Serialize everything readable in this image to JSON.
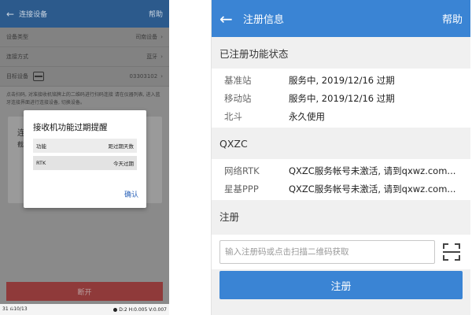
{
  "left_screen": {
    "app_bar": {
      "title": "连接设备",
      "help": "帮助"
    },
    "rows": [
      {
        "label": "设备类型",
        "value": "司南设备"
      },
      {
        "label": "连接方式",
        "value": "蓝牙"
      },
      {
        "label": "目标设备",
        "value": "03303102"
      }
    ],
    "description": "点击扫码, 对准接收机铭牌上的二维码进行扫码连接\n请在仪器列表, 进入蓝牙连接界面进行连接设备, 切换设备。",
    "background_card": {
      "line1": "连",
      "line2": "截"
    },
    "dialog": {
      "title": "接收机功能过期提醒",
      "table_header": {
        "col1": "功能",
        "col2": "距过期天数"
      },
      "table_rows": [
        {
          "col1": "RTK",
          "col2": "今天过期"
        }
      ],
      "ok_label": "确认"
    },
    "disconnect_button": "断开",
    "status_bar": {
      "left": "31 ⎌10/13",
      "right": "D:2 H:0.005 V:0.007"
    }
  },
  "right_screen": {
    "app_bar": {
      "back_icon": "←",
      "title": "注册信息",
      "help": "帮助"
    },
    "registered_section_title": "已注册功能状态",
    "registered_items": [
      {
        "key": "基准站",
        "value": "服务中, 2019/12/16 过期"
      },
      {
        "key": "移动站",
        "value": "服务中, 2019/12/16 过期"
      },
      {
        "key": "北斗",
        "value": "永久使用"
      }
    ],
    "qxzc_section_title": "QXZC",
    "qxzc_items": [
      {
        "key": "网络RTK",
        "value": "QXZC服务帐号未激活, 请到qxwz.com..."
      },
      {
        "key": "星基PPP",
        "value": "QXZC服务帐号未激活, 请到qxwz.com..."
      }
    ],
    "register_section_title": "注册",
    "register_input": {
      "placeholder": "输入注册码或点击扫描二维码获取",
      "value": ""
    },
    "register_button": "注册"
  },
  "colors": {
    "accent_blue": "#3a84d4",
    "dialog_link": "#2a62b8",
    "disconnect_red": "#8f3a3a"
  }
}
